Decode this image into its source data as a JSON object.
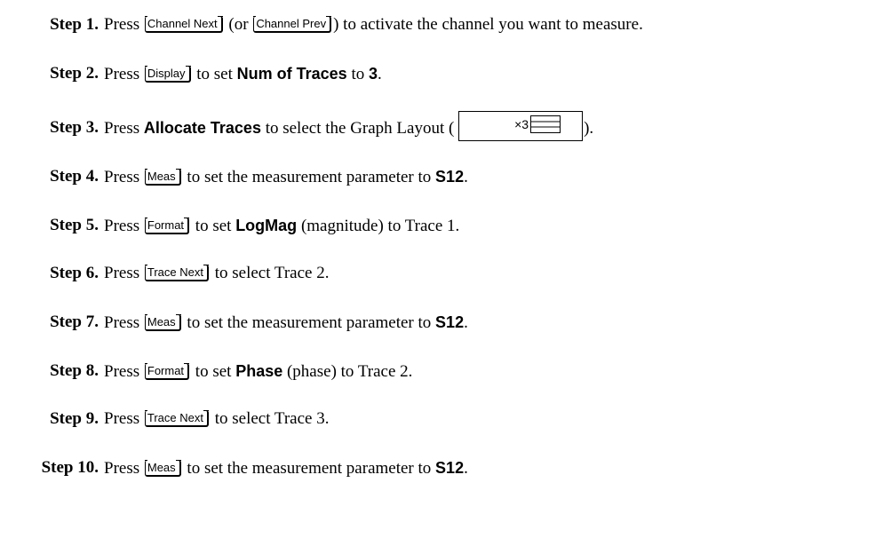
{
  "steps": [
    {
      "label": "Step 1.",
      "parts": [
        "Press ",
        "Channel Next",
        " (or ",
        "Channel Prev",
        ") to activate the channel you want to measure."
      ]
    },
    {
      "label": "Step 2.",
      "parts": [
        "Press ",
        "Display",
        " to set ",
        "Num of Traces",
        " to ",
        "3",
        "."
      ]
    },
    {
      "label": "Step 3.",
      "parts": [
        "Press ",
        "Allocate Traces",
        " to select the Graph Layout ( ",
        "×3",
        ")."
      ]
    },
    {
      "label": "Step 4.",
      "parts": [
        "Press ",
        "Meas",
        " to set the measurement parameter to ",
        "S12",
        "."
      ]
    },
    {
      "label": "Step 5.",
      "parts": [
        "Press ",
        "Format",
        " to set ",
        "LogMag",
        " (magnitude) to Trace 1."
      ]
    },
    {
      "label": "Step 6.",
      "parts": [
        "Press ",
        "Trace Next",
        " to select Trace 2."
      ]
    },
    {
      "label": "Step 7.",
      "parts": [
        "Press ",
        "Meas",
        " to set the measurement parameter to ",
        "S12",
        "."
      ]
    },
    {
      "label": "Step 8.",
      "parts": [
        "Press ",
        "Format",
        " to set ",
        "Phase",
        " (phase) to Trace 2."
      ]
    },
    {
      "label": "Step 9.",
      "parts": [
        "Press ",
        "Trace Next",
        " to select Trace 3."
      ]
    },
    {
      "label": "Step 10.",
      "parts": [
        "Press ",
        "Meas",
        " to set the measurement parameter to ",
        "S12",
        "."
      ]
    }
  ],
  "icons": {
    "layout": "three-horizontal-graphs-icon"
  }
}
